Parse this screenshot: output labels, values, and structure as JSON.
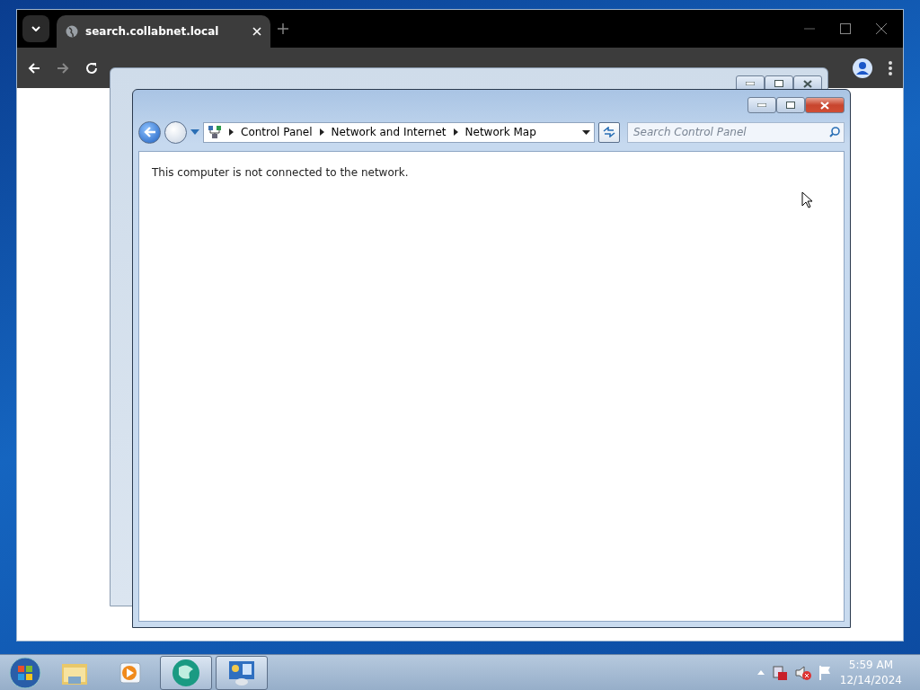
{
  "browser": {
    "tab": {
      "title": "search.collabnet.local",
      "selected": true
    }
  },
  "back_window": {
    "active": false
  },
  "window": {
    "active": true,
    "breadcrumb": [
      "Control Panel",
      "Network and Internet",
      "Network Map"
    ],
    "search": {
      "placeholder": "Search Control Panel"
    },
    "message": "This computer is not connected to the network."
  },
  "taskbar": {
    "apps": [
      {
        "kind": "folder",
        "running": false
      },
      {
        "kind": "media",
        "running": false
      },
      {
        "kind": "globe",
        "running": true
      },
      {
        "kind": "panel",
        "running": true
      }
    ],
    "clock": {
      "time": "5:59 AM",
      "date": "12/14/2024"
    }
  }
}
